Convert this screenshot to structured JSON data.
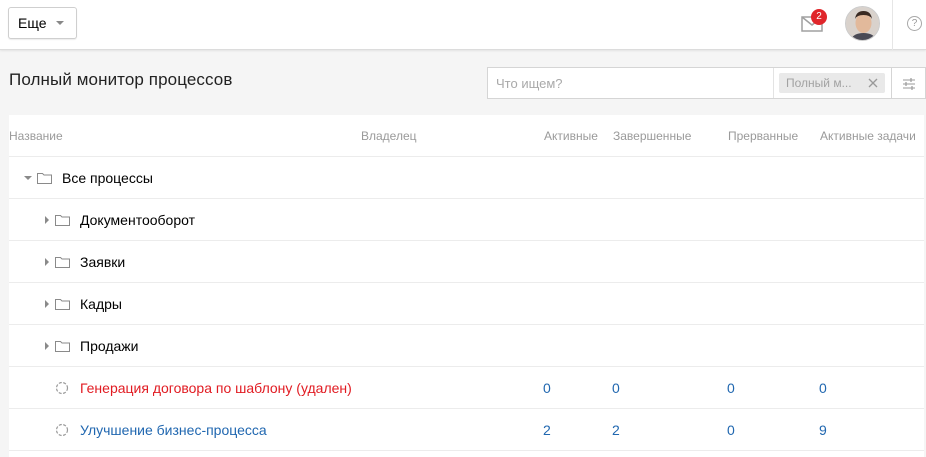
{
  "topbar": {
    "more_label": "Еще",
    "mail_count": "2",
    "help_label": "?"
  },
  "page": {
    "title": "Полный монитор процессов"
  },
  "search": {
    "placeholder": "Что ищем?",
    "chip_label": "Полный м..."
  },
  "table": {
    "columns": {
      "name": "Название",
      "owner": "Владелец",
      "active": "Активные",
      "completed": "Завершенные",
      "interrupted": "Прерванные",
      "active_tasks": "Активные задачи"
    },
    "root": {
      "label": "Все процессы"
    },
    "folders": [
      {
        "label": "Документооборот"
      },
      {
        "label": "Заявки"
      },
      {
        "label": "Кадры"
      },
      {
        "label": "Продажи"
      }
    ],
    "processes": [
      {
        "label": "Генерация договора по шаблону (удален)",
        "status_color": "#e11b22",
        "active": "0",
        "completed": "0",
        "interrupted": "0",
        "active_tasks": "0"
      },
      {
        "label": "Улучшение бизнес-процесса",
        "status_color": "#2067b0",
        "active": "2",
        "completed": "2",
        "interrupted": "0",
        "active_tasks": "9"
      }
    ]
  },
  "icons": [
    "chevron-down-icon",
    "mail-icon",
    "avatar",
    "help-icon",
    "close-icon",
    "filter-settings-icon",
    "folder-icon",
    "process-icon",
    "expand-arrow-icon",
    "collapse-arrow-icon"
  ]
}
